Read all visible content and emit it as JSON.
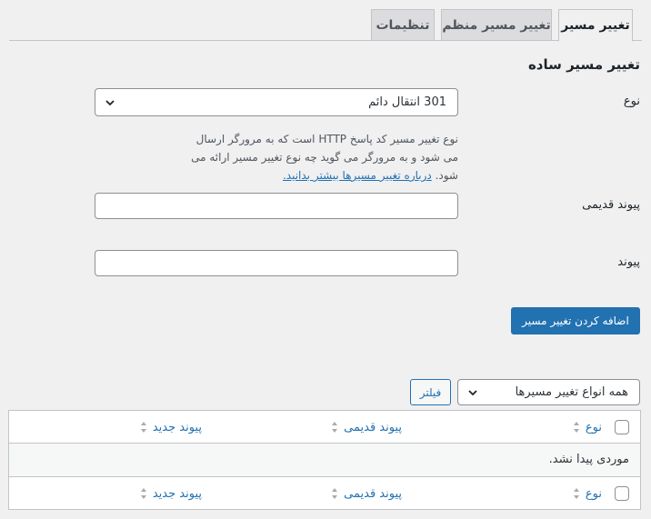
{
  "tabs": [
    {
      "label": "تغییر مسیر",
      "active": true
    },
    {
      "label": "تغییر مسیر منظم",
      "active": false
    },
    {
      "label": "تنظیمات",
      "active": false
    }
  ],
  "form": {
    "title": "تغییر مسیر ساده",
    "type_label": "نوع",
    "type_value": "301 انتقال دائم",
    "description_text": "نوع تغییر مسیر کد پاسخ HTTP است که به مرورگر ارسال می شود و به مرورگر می گوید چه نوع تغییر مسیر ارائه می شود.",
    "description_link": "درباره تغییر مسیرها بیشتر بدانید.",
    "old_link_label": "پیوند قدیمی",
    "old_link_value": "",
    "new_link_label": "پیوند",
    "new_link_value": "",
    "submit_label": "اضافه کردن تغییر مسیر"
  },
  "filter": {
    "select_value": "همه انواع تغییر مسیرها",
    "button_label": "فیلتر"
  },
  "table": {
    "columns": [
      "نوع",
      "پیوند قدیمی",
      "پیوند جدید"
    ],
    "empty_message": "موردی پیدا نشد."
  },
  "colors": {
    "accent": "#2271b1",
    "background": "#f0f0f1",
    "border": "#c3c4c7"
  }
}
